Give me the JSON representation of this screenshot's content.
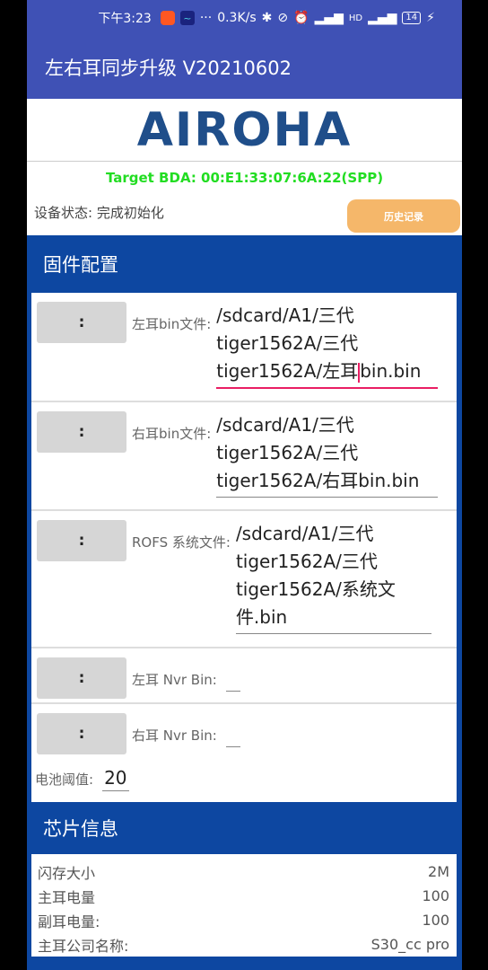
{
  "status_bar": {
    "time": "下午3:23",
    "speed": "0.3K/s",
    "battery": "14"
  },
  "app": {
    "title": "左右耳同步升级 V20210602"
  },
  "logo": {
    "text": "AIROHA"
  },
  "device": {
    "target_bda": "Target BDA: 00:E1:33:07:6A:22(SPP)",
    "status_label": "设备状态:",
    "status_value": "完成初始化",
    "history_button": "历史记录"
  },
  "firmware": {
    "section_title": "固件配置",
    "rows": [
      {
        "button": ":",
        "label": "左耳bin文件:",
        "value_before_caret": "/sdcard/A1/三代tiger1562A/三代tiger1562A/左耳",
        "value_after_caret": "bin.bin"
      },
      {
        "button": ":",
        "label": "右耳bin文件:",
        "value": "/sdcard/A1/三代tiger1562A/三代tiger1562A/右耳bin.bin"
      },
      {
        "button": ":",
        "label": "ROFS 系统文件:",
        "value": "/sdcard/A1/三代tiger1562A/三代tiger1562A/系统文件.bin"
      },
      {
        "button": ":",
        "label": "左耳 Nvr Bin:",
        "value": ""
      },
      {
        "button": ":",
        "label": "右耳 Nvr Bin:",
        "value": ""
      }
    ],
    "battery_label": "电池阈值:",
    "battery_value": "20"
  },
  "chip": {
    "section_title": "芯片信息",
    "rows": [
      {
        "label": "闪存大小",
        "value": "2M"
      },
      {
        "label": "主耳电量",
        "value": "100"
      },
      {
        "label": "副耳电量:",
        "value": "100"
      },
      {
        "label": "主耳公司名称:",
        "value": "S30_cc pro"
      }
    ]
  }
}
